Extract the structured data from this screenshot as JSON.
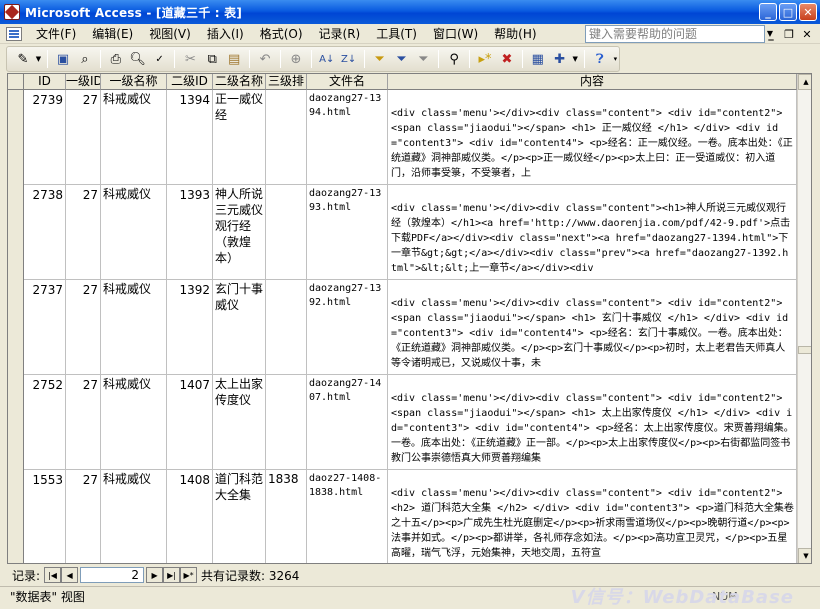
{
  "window": {
    "title": "Microsoft Access - [道藏三千 : 表]"
  },
  "menu": {
    "items": [
      "文件(F)",
      "编辑(E)",
      "视图(V)",
      "插入(I)",
      "格式(O)",
      "记录(R)",
      "工具(T)",
      "窗口(W)",
      "帮助(H)"
    ],
    "help_placeholder": "键入需要帮助的问题"
  },
  "toolbar": {
    "icons": [
      "design-view-icon",
      "save-icon",
      "search-file-icon",
      "print-icon",
      "print-preview-icon",
      "spelling-icon",
      "cut-icon",
      "copy-icon",
      "paste-icon",
      "undo-icon",
      "hyperlink-icon",
      "sort-ascending-icon",
      "sort-descending-icon",
      "filter-by-selection-icon",
      "filter-by-form-icon",
      "apply-filter-icon",
      "find-icon",
      "new-record-icon",
      "delete-record-icon",
      "database-window-icon",
      "new-object-icon",
      "help-icon"
    ]
  },
  "table": {
    "columns": [
      "ID",
      "一级ID",
      "一级名称",
      "二级ID",
      "二级名称",
      "三级排",
      "文件名",
      "内容"
    ],
    "rows": [
      {
        "id": "2739",
        "l1id": "27",
        "l1name": "科戒威仪",
        "l2id": "1394",
        "l2name": "正一威仪经",
        "l3": "",
        "file": "daozang27-1394.html",
        "content": "<div class='menu'></div><div class=\"content\"> <div id=\"content2\"> <span class=\"jiaodui\"></span> <h1> 正一威仪经 </h1> </div> <div id=\"content3\"> <div id=\"content4\"> <p>经名：正一威仪经。一卷。底本出处：《正统道藏》洞神部威仪类。</p><p>正一威仪经</p><p>太上曰：正一受道威仪：初入道门，沿师事受箓，不受箓者，上"
      },
      {
        "id": "2738",
        "l1id": "27",
        "l1name": "科戒威仪",
        "l2id": "1393",
        "l2name": "神人所说三元威仪观行经（敦煌本）",
        "l3": "",
        "file": "daozang27-1393.html",
        "content": "<div class='menu'></div><div class=\"content\"><h1>神人所说三元威仪观行经（敦煌本）</h1><a href='http://www.daorenjia.com/pdf/42-9.pdf'>点击下载PDF</a></div><div class=\"next\"><a href=\"daozang27-1394.html\">下一章节&gt;&gt;</a></div><div class=\"prev\"><a href=\"daozang27-1392.html\">&lt;&lt;上一章节</a></div><div"
      },
      {
        "id": "2737",
        "l1id": "27",
        "l1name": "科戒威仪",
        "l2id": "1392",
        "l2name": "玄门十事威仪",
        "l3": "",
        "file": "daozang27-1392.html",
        "content": "<div class='menu'></div><div class=\"content\"> <div id=\"content2\"> <span class=\"jiaodui\"></span> <h1> 玄门十事威仪 </h1> </div> <div id=\"content3\"> <div id=\"content4\"> <p>经名：玄门十事威仪。一卷。底本出处：《正统道藏》洞神部威仪类。</p><p>玄门十事威仪</p><p>初时，太上老君告天师真人等令诸明戒已，又说威仪十事，未"
      },
      {
        "id": "2752",
        "l1id": "27",
        "l1name": "科戒威仪",
        "l2id": "1407",
        "l2name": "太上出家传度仪",
        "l3": "",
        "file": "daozang27-1407.html",
        "content": "<div class='menu'></div><div class=\"content\"> <div id=\"content2\"> <span class=\"jiaodui\"></span> <h1> 太上出家传度仪 </h1> </div> <div id=\"content3\"> <div id=\"content4\"> <p>经名：太上出家传度仪。宋贾善翔编集。一卷。底本出处：《正统道藏》正一部。</p><p>太上出家传度仪</p><p>右街都监同签书教门公事崇德悟真大师贾善翔编集"
      },
      {
        "id": "1553",
        "l1id": "27",
        "l1name": "科戒威仪",
        "l2id": "1408",
        "l2name": "道门科范大全集",
        "l3": "1838",
        "file": "daoz27-1408-1838.html",
        "content": "<div class='menu'></div><div class=\"content\"> <div id=\"content2\"> <h2> 道门科范大全集 </h2> </div> <div id=\"content3\"> <p>道门科范大全集卷之十五</p><p>广成先生杜光庭删定</p><p>祈求雨雪道场仪</p><p>晚朝行道</p><p>法事并如式。</p><p>都讲举，各礼师存念如法。</p><p>高功宣卫灵咒，</p><p>五星高曜，瑞气飞浮，元始集神，天地交周，五符宣"
      }
    ]
  },
  "navigation": {
    "label": "记录:",
    "current": "2",
    "total_label": "共有记录数: 3264"
  },
  "status": {
    "view_text": "\"数据表\" 视图",
    "mode": "NUM",
    "watermark": "V信号：WebDataBase"
  }
}
